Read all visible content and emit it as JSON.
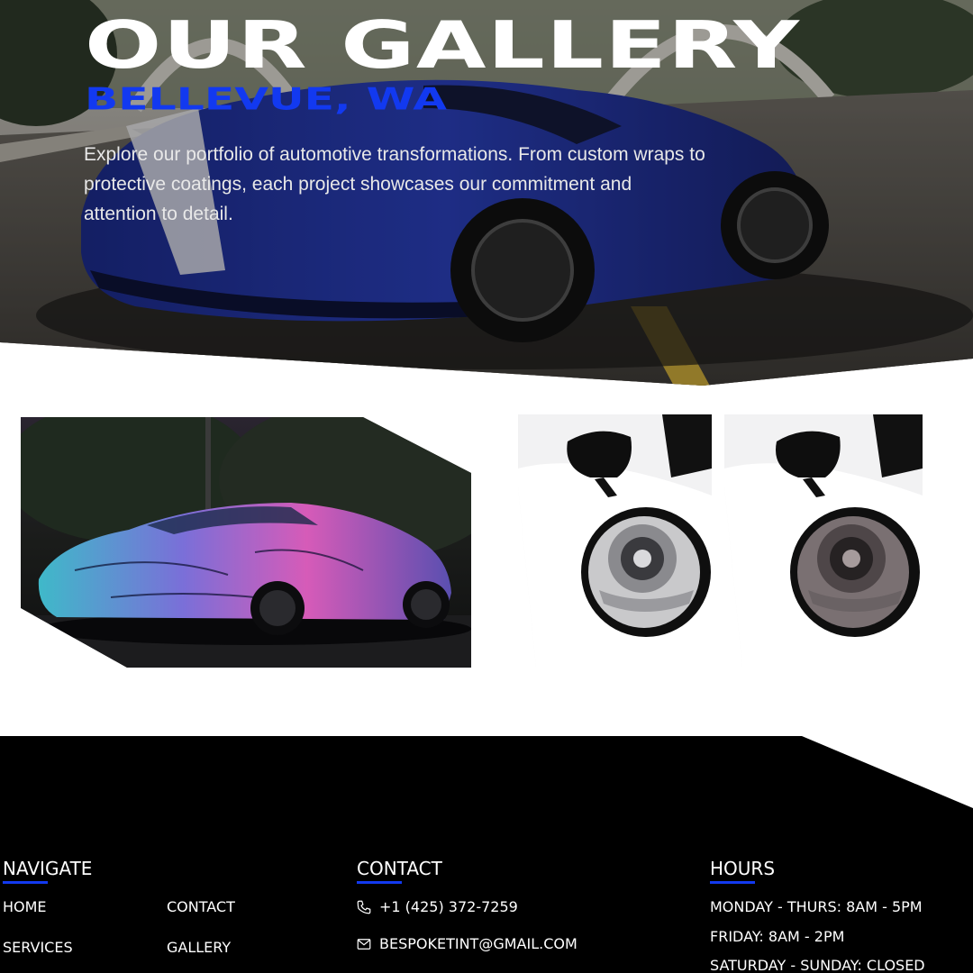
{
  "hero": {
    "title": "OUR GALLERY",
    "subtitle": "BELLEVUE, WA",
    "description": "Explore our portfolio of automotive transformations. From custom wraps to protective coatings, each project showcases our commitment and attention to detail.",
    "image_subject": "blue sports car with white racing stripes parked on asphalt road"
  },
  "gallery": {
    "images": [
      {
        "subject": "supercar with purple and teal graffiti art wrap at dusk"
      },
      {
        "subject": "white car headlight close-up with clear lens"
      },
      {
        "subject": "white car headlight close-up with smoked tint"
      }
    ]
  },
  "footer": {
    "navigate": {
      "heading": "NAVIGATE",
      "links": [
        "HOME",
        "CONTACT",
        "SERVICES",
        "GALLERY"
      ]
    },
    "contact": {
      "heading": "CONTACT",
      "phone": "+1 (425) 372-7259",
      "email": "BESPOKETINT@GMAIL.COM",
      "phone_icon": "phone-icon",
      "email_icon": "mail-icon"
    },
    "hours": {
      "heading": "HOURS",
      "lines": [
        "MONDAY - THURS: 8AM - 5PM",
        "FRIDAY: 8AM - 2PM",
        "SATURDAY - SUNDAY: CLOSED"
      ]
    }
  },
  "colors": {
    "accent": "#1239f0",
    "footer_bg": "#000000",
    "text_light": "#ffffff"
  }
}
